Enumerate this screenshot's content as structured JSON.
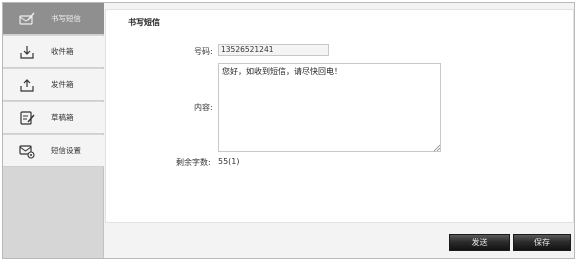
{
  "sidebar": {
    "items": [
      {
        "label": "书写短信",
        "icon": "pencil-envelope-icon"
      },
      {
        "label": "收件箱",
        "icon": "inbox-download-icon"
      },
      {
        "label": "发件箱",
        "icon": "outbox-upload-icon"
      },
      {
        "label": "草稿箱",
        "icon": "draft-edit-icon"
      },
      {
        "label": "短信设置",
        "icon": "envelope-gear-icon"
      }
    ]
  },
  "main": {
    "title": "书写短信",
    "number_label": "号码:",
    "number_value": "13526521241",
    "content_label": "内容:",
    "content_value": "您好，如收到短信，请尽快回电！",
    "remaining_label": "剩余字数:",
    "remaining_value": "55(1)"
  },
  "footer": {
    "send_label": "发送",
    "save_label": "保存"
  },
  "colors": {
    "active_sidebar": "#8f8f8f",
    "button_dark": "#1b1b1b"
  }
}
